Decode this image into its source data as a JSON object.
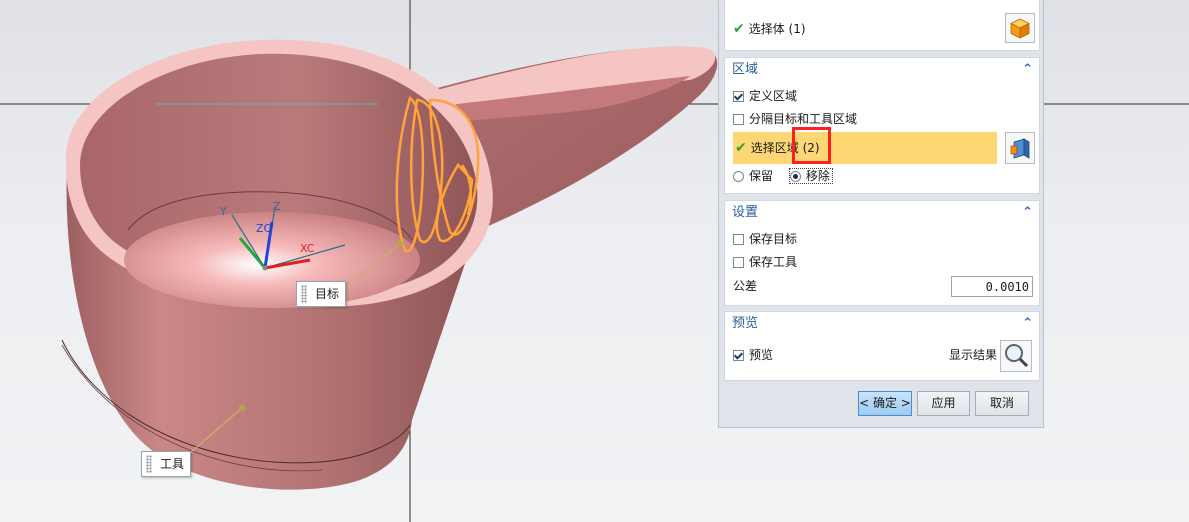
{
  "viewport": {
    "labels": {
      "target": "目标",
      "tool": "工具"
    },
    "triad_axes": {
      "x": "XC",
      "y": "Y",
      "z": "Z",
      "zc": "ZC"
    },
    "colors": {
      "body": "#b06f6f",
      "rim": "#f4c5c2",
      "highlight_edges": "#ffa33a",
      "background": "#e6e8ec"
    }
  },
  "dialog": {
    "top_section": {
      "select_body_label": "选择体 (1)",
      "cube_icon": "cube-icon"
    },
    "region": {
      "title": "区域",
      "define_region_label": "定义区域",
      "define_region_checked": true,
      "split_label": "分隔目标和工具区域",
      "split_checked": false,
      "select_region_label": "选择区域",
      "select_region_count": "(2)",
      "keep_label": "保留",
      "remove_label": "移除",
      "selected_option": "移除"
    },
    "settings": {
      "title": "设置",
      "keep_target_label": "保存目标",
      "keep_target_checked": false,
      "keep_tool_label": "保存工具",
      "keep_tool_checked": false,
      "tolerance_label": "公差",
      "tolerance_value": "0.0010"
    },
    "preview": {
      "title": "预览",
      "preview_label": "预览",
      "preview_checked": true,
      "show_result_label": "显示结果"
    },
    "buttons": {
      "ok": "< 确定 >",
      "apply": "应用",
      "cancel": "取消"
    },
    "colors": {
      "section_title": "#2a5d9c",
      "selected_row": "#fdd774",
      "check": "#2da52d",
      "annotation": "#ff1f1f"
    }
  }
}
